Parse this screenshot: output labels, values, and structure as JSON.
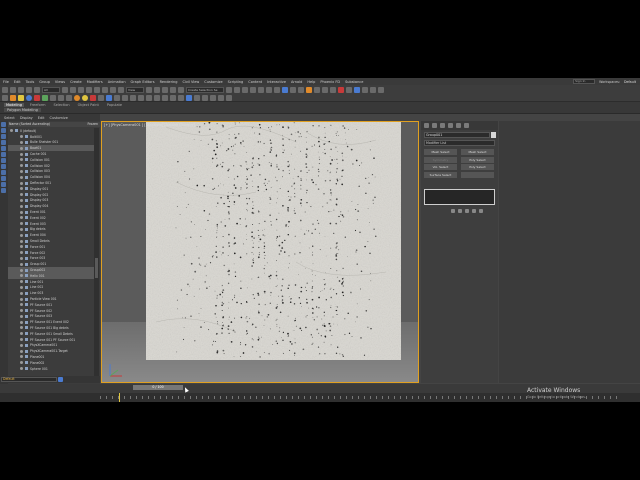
{
  "menu": {
    "items": [
      "File",
      "Edit",
      "Tools",
      "Group",
      "Views",
      "Create",
      "Modifiers",
      "Animation",
      "Graph Editors",
      "Rendering",
      "Civil View",
      "Customize",
      "Scripting",
      "Content",
      "Interactive",
      "Arnold",
      "Help",
      "Phoenix FD",
      "Substance"
    ],
    "signin": "Sign In",
    "workspaces_label": "Workspaces:",
    "workspace_value": "Default"
  },
  "toolbar": {
    "view_dropdown": "View",
    "selection_set": "Create Selection Se"
  },
  "ribbon": {
    "tabs": [
      "Modeling",
      "Freeform",
      "Selection",
      "Object Paint",
      "Populate"
    ],
    "active_sub": "Polygon Modeling"
  },
  "scene_explorer": {
    "tabs": [
      "Select",
      "Display",
      "Edit",
      "Customize"
    ],
    "header": "Name (Sorted Ascending)",
    "frozen_col": "Frozen",
    "rows": [
      "0 (default)",
      "Bolt001",
      "Bulle Shelster 001",
      "Bowl01",
      "Cache 001",
      "Collision 001",
      "Collision 002",
      "Collision 003",
      "Collision 004",
      "Deflector 001",
      "Display 001",
      "Display 002",
      "Display 003",
      "Display 004",
      "Event 001",
      "Event 002",
      "Event 003",
      "Big debris",
      "Event 004",
      "Small Debris",
      "Force 001",
      "Force 002",
      "Force 003",
      "Group 001",
      "Group002",
      "Helix 001",
      "Line 001",
      "Line 002",
      "Line 003",
      "Particle View 001",
      "PF Source 001",
      "PF Source 002",
      "PF Source 003",
      "PF Source 001 Event 002",
      "PF Source 001 Big debris",
      "PF Source 001 Small Debris",
      "PF Source 001 PF Source 001",
      "PhysXCamera001",
      "PhysXCamera001.Target",
      "Plane001",
      "Plane002",
      "Sphere 001"
    ],
    "selected_rows": [
      3,
      24,
      25
    ],
    "layer": "Default"
  },
  "viewport": {
    "label": "[+] [PhysCamera001 ] [Standard] [Default Shading]"
  },
  "command_panel": {
    "object_name": "Group001",
    "modifier_list": "Modifier List",
    "modifier_buttons": [
      "Mesh Select",
      "Mesh Select",
      "Symmetry",
      "Poly Select",
      "Vol. Select",
      "Poly Select",
      "Surface Select",
      ""
    ],
    "dim_buttons": [
      2,
      7
    ]
  },
  "timeline": {
    "slider": "0 / 100"
  },
  "windows": {
    "activate_title": "Activate Windows",
    "activate_sub": "Go to Settings to activate Windows."
  },
  "colors": {
    "viewport_border": "#e0a020",
    "accent_blue": "#4a7bd1",
    "layer_text": "#e8b548"
  }
}
